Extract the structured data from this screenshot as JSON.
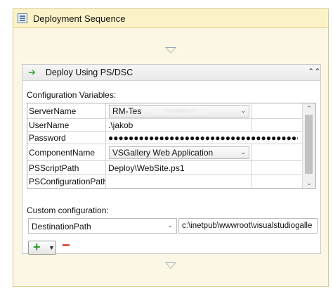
{
  "sequence": {
    "title": "Deployment Sequence"
  },
  "activity": {
    "title": "Deploy Using PS/DSC",
    "config_label": "Configuration Variables:",
    "rows": [
      {
        "name": "ServerName",
        "value": "RM-Tes"
      },
      {
        "name": "UserName",
        "value": ".\\jakob"
      },
      {
        "name": "Password",
        "value": "●●●●●●●●●●●●●●●●●●●●●●●●●●●●●●●●●●●●●●"
      },
      {
        "name": "ComponentName",
        "value": "VSGallery Web Application"
      },
      {
        "name": "PSScriptPath",
        "value": "Deploy\\WebSite.ps1"
      },
      {
        "name": "PSConfigurationPath",
        "value": ""
      }
    ],
    "custom_label": "Custom configuration:",
    "custom_name": "DestinationPath",
    "custom_value": "c:\\inetpub\\wwwroot\\visualstudiogalle"
  },
  "icons": {
    "sequence": "sequence-icon",
    "activity": "green-arrow-icon",
    "collapse": "double-chevron-up-icon",
    "add": "plus-icon",
    "remove": "minus-icon"
  },
  "colors": {
    "add": "#2f9a2f",
    "remove": "#d42020",
    "sequence_header": "#fcf2c7"
  }
}
